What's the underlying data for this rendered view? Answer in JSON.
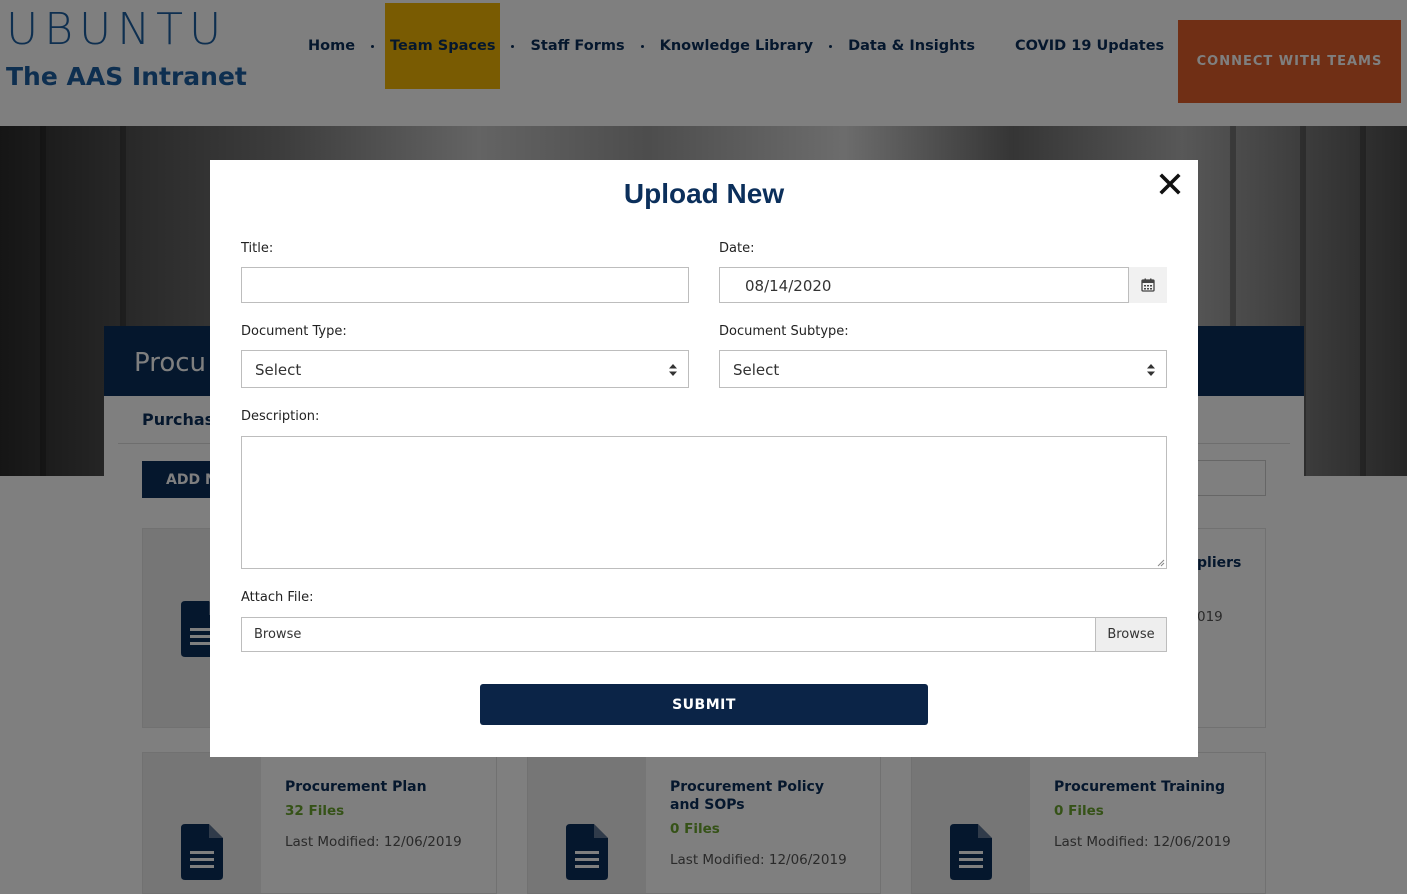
{
  "header": {
    "logo_word": "UBUNTU",
    "logo_sub": "The AAS Intranet",
    "nav": [
      {
        "label": "Home"
      },
      {
        "label": "Team Spaces",
        "active": true
      },
      {
        "label": "Staff Forms"
      },
      {
        "label": "Knowledge Library"
      },
      {
        "label": "Data & Insights"
      },
      {
        "label": "COVID 19 Updates"
      }
    ],
    "connect_label": "CONNECT WITH TEAMS"
  },
  "hero": {
    "banner_title": "Procu"
  },
  "page": {
    "tab_label": "Purchas",
    "add_button_label": "ADD N",
    "cards_top_left": {
      "partial": true
    },
    "card_peek_title": "ppliers",
    "card_peek_date": "019",
    "cards": [
      {
        "title": "Procurement Plan",
        "files": "32 Files",
        "modified": "Last Modified: 12/06/2019"
      },
      {
        "title": "Procurement Policy and SOPs",
        "files": "0 Files",
        "modified": "Last Modified: 12/06/2019"
      },
      {
        "title": "Procurement Training",
        "files": "0 Files",
        "modified": "Last Modified: 12/06/2019"
      }
    ]
  },
  "modal": {
    "title": "Upload New",
    "close_icon": "close-icon",
    "title_label": "Title:",
    "title_value": "",
    "date_label": "Date:",
    "date_value": "08/14/2020",
    "doc_type_label": "Document Type:",
    "doc_type_value": "Select",
    "doc_subtype_label": "Document Subtype:",
    "doc_subtype_value": "Select",
    "description_label": "Description:",
    "attach_label": "Attach File:",
    "file_placeholder": "Browse",
    "browse_label": "Browse",
    "submit_label": "SUBMIT"
  },
  "colors": {
    "brand_navy": "#0b2f5b",
    "active_nav": "#f2b705",
    "connect_orange": "#e05f2a",
    "files_green": "#6aa42f"
  }
}
